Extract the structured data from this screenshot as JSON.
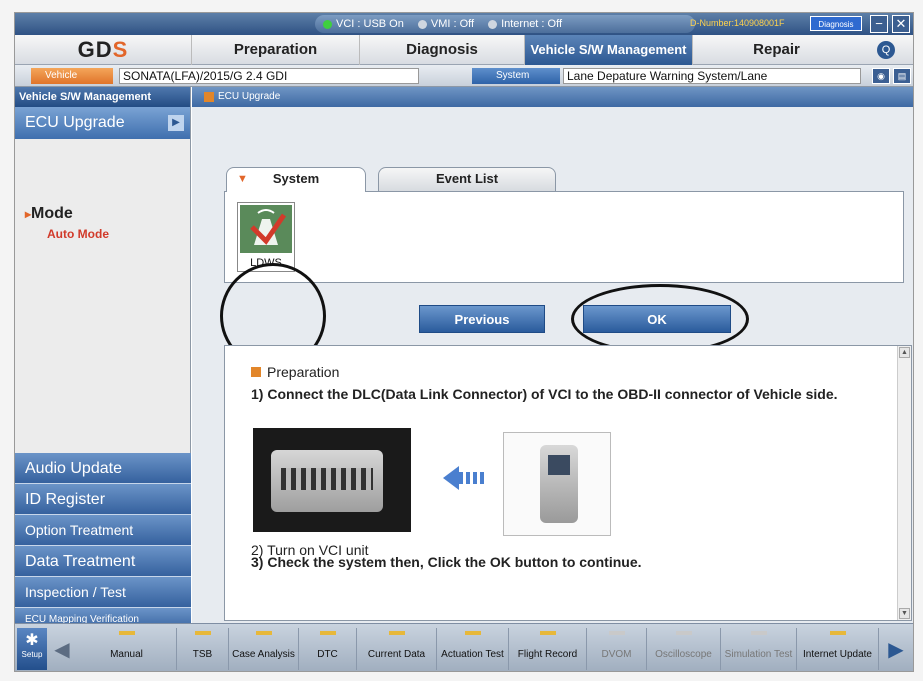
{
  "titlebar": {
    "vci": "VCI : USB On",
    "vmi": "VMI : Off",
    "internet": "Internet : Off",
    "d_number": "D-Number:140908001F",
    "diag_finish": "Diagnosis Finish",
    "minimize_glyph": "−",
    "close_glyph": "✕"
  },
  "menubar": {
    "logo_main": "GD",
    "logo_accent": "S",
    "items": [
      "Preparation",
      "Diagnosis",
      "Vehicle S/W Management",
      "Repair"
    ],
    "search_glyph": "Q"
  },
  "vehicle_bar": {
    "vehicle_tag": "Vehicle",
    "vehicle_value": "SONATA(LFA)/2015/G 2.4 GDI",
    "system_tag": "System",
    "system_value": "Lane Depature Warning System/Lane"
  },
  "sidebar": {
    "header": "Vehicle S/W Management",
    "active_item": "ECU Upgrade",
    "mode_label": "Mode",
    "mode_value": "Auto Mode",
    "items": [
      "Audio Update",
      "ID Register",
      "Option Treatment",
      "Data Treatment",
      "Inspection / Test",
      "ECU Mapping Verification"
    ]
  },
  "content": {
    "breadcrumb": "ECU Upgrade",
    "tabs": [
      "System",
      "Event List"
    ],
    "system_icon_label": "LDWS",
    "buttons": {
      "previous": "Previous",
      "ok": "OK"
    },
    "preparation": {
      "title": "Preparation",
      "step1": "1) Connect the DLC(Data Link Connector) of VCI to the OBD-II connector of Vehicle side.",
      "step2": "2) Turn on VCI unit",
      "step3": "3) Check the system then, Click the OK button to continue."
    }
  },
  "toolbar": {
    "setup": "Setup",
    "items": [
      "Manual",
      "TSB",
      "Case Analysis",
      "DTC",
      "Current Data",
      "Actuation Test",
      "Flight Record",
      "DVOM",
      "Oscilloscope",
      "Simulation Test",
      "Internet Update"
    ]
  },
  "colors": {
    "accent_blue": "#2c5892",
    "accent_orange": "#e2662a",
    "status_green": "#3fcf3f"
  }
}
